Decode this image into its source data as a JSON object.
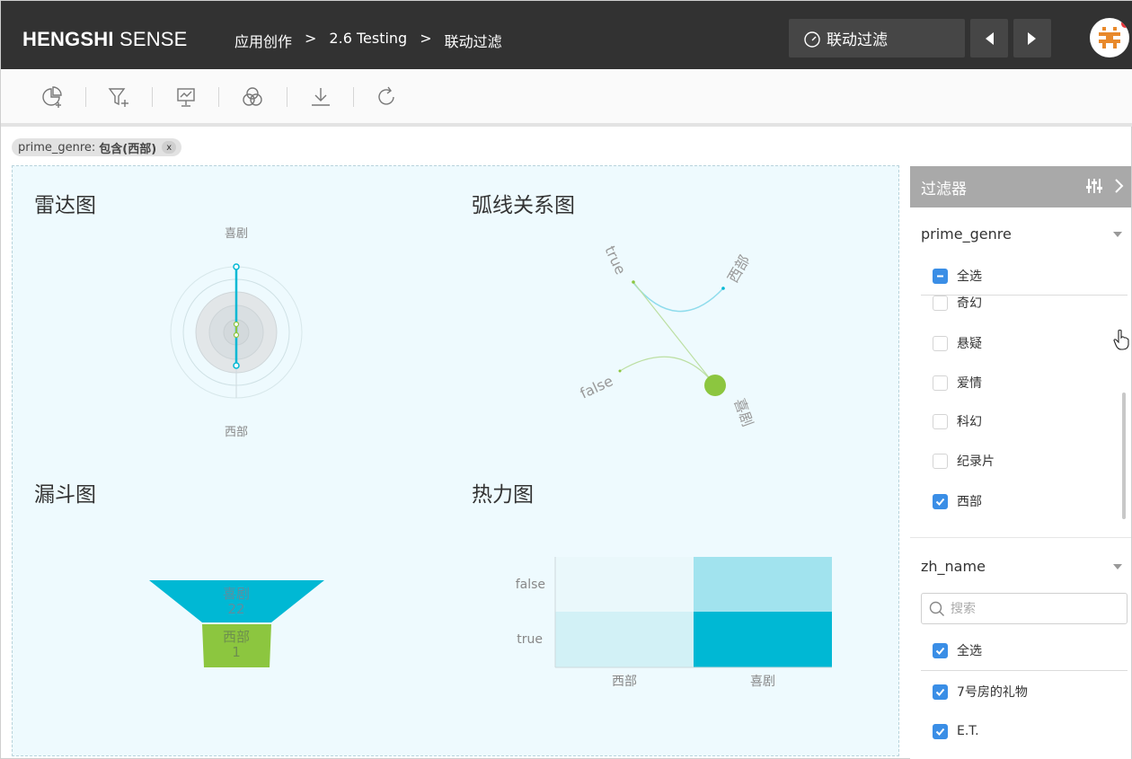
{
  "app": {
    "brand_bold": "HENGSHI",
    "brand_light": " SENSE"
  },
  "breadcrumb": {
    "items": [
      "应用创作",
      "2.6 Testing",
      "联动过滤"
    ],
    "sep": ">"
  },
  "header": {
    "dashboard_name": "联动过滤"
  },
  "toolbar": {
    "icons": [
      "add-chart-icon",
      "add-filter-icon",
      "presentation-icon",
      "venn-icon",
      "download-icon",
      "refresh-icon"
    ]
  },
  "filter_tag": {
    "field": "prime_genre:",
    "value": "包含(西部)",
    "close": "x"
  },
  "charts": {
    "radar": {
      "title": "雷达图",
      "top_label": "喜剧",
      "bottom_label": "西部"
    },
    "arc": {
      "title": "弧线关系图",
      "nodes": [
        "true",
        "西部",
        "false",
        "喜剧"
      ]
    },
    "funnel": {
      "title": "漏斗图",
      "stages": [
        {
          "name": "喜剧",
          "value": "22"
        },
        {
          "name": "西部",
          "value": "1"
        }
      ]
    },
    "heatmap": {
      "title": "热力图",
      "y_labels": [
        "false",
        "true"
      ],
      "x_labels": [
        "西部",
        "喜剧"
      ]
    }
  },
  "chart_data": [
    {
      "type": "radar",
      "title": "雷达图",
      "categories": [
        "喜剧",
        "西部"
      ]
    },
    {
      "type": "other",
      "title": "弧线关系图",
      "nodes": [
        "true",
        "西部",
        "false",
        "喜剧"
      ],
      "links": [
        [
          "true",
          "西部"
        ],
        [
          "true",
          "喜剧"
        ],
        [
          "false",
          "喜剧"
        ]
      ]
    },
    {
      "type": "other",
      "title": "漏斗图",
      "categories": [
        "喜剧",
        "西部"
      ],
      "values": [
        22,
        1
      ]
    },
    {
      "type": "heatmap",
      "title": "热力图",
      "x": [
        "西部",
        "喜剧"
      ],
      "y": [
        "false",
        "true"
      ],
      "values": [
        [
          0.05,
          0.4
        ],
        [
          0.15,
          1.0
        ]
      ]
    }
  ],
  "filter_panel": {
    "title": "过滤器",
    "sections": [
      {
        "field": "prime_genre",
        "select_all": "全选",
        "options": [
          {
            "label": "奇幻",
            "checked": false
          },
          {
            "label": "悬疑",
            "checked": false
          },
          {
            "label": "爱情",
            "checked": false
          },
          {
            "label": "科幻",
            "checked": false
          },
          {
            "label": "纪录片",
            "checked": false
          },
          {
            "label": "西部",
            "checked": true
          }
        ]
      },
      {
        "field": "zh_name",
        "search_placeholder": "搜索",
        "select_all": "全选",
        "options": [
          {
            "label": "7号房的礼物",
            "checked": true
          },
          {
            "label": "E.T.",
            "checked": true
          }
        ]
      }
    ]
  },
  "colors": {
    "header_bg": "#323232",
    "accent": "#00b8d4",
    "green": "#8cc63f",
    "checkbox": "#3a8ee6"
  }
}
